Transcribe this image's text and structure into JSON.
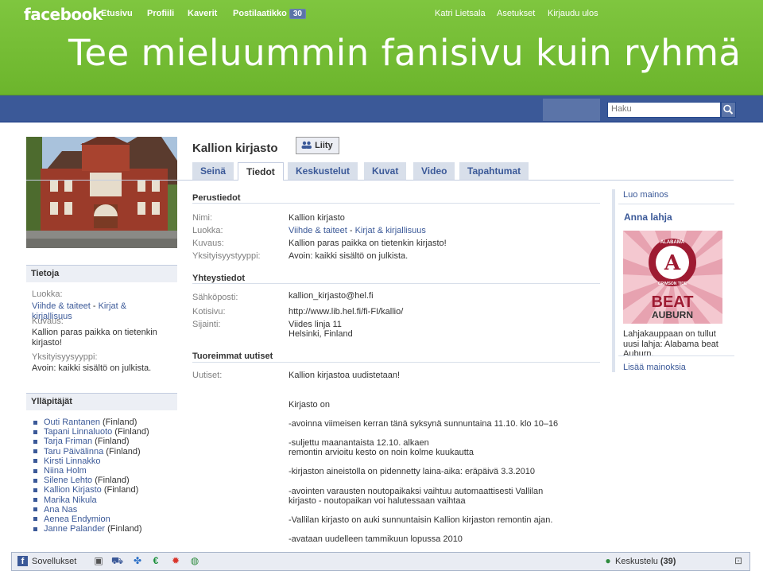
{
  "slide": {
    "title": "Tee mieluummin fanisivu kuin ryhmä"
  },
  "topbar": {
    "logo": "facebook",
    "nav": [
      "Etusivu",
      "Profiili",
      "Kaverit",
      "Postilaatikko"
    ],
    "inbox_count": "30",
    "user": "Katri Lietsala",
    "settings": "Asetukset",
    "logout": "Kirjaudu ulos",
    "search_placeholder": "Haku"
  },
  "page": {
    "name": "Kallion kirjasto",
    "join_label": "Liity",
    "tabs": [
      "Seinä",
      "Tiedot",
      "Keskustelut",
      "Kuvat",
      "Video",
      "Tapahtumat"
    ],
    "active_tab": "Tiedot"
  },
  "sidebar": {
    "info_heading": "Tietoja",
    "category_label": "Luokka:",
    "category_part1": "Viihde & taiteet",
    "category_sep": " - ",
    "category_part2": "Kirjat & kirjallisuus",
    "description_label": "Kuvaus:",
    "description": "Kallion paras paikka on tietenkin kirjasto!",
    "privacy_label": "Yksityisyysyyppi:",
    "privacy": "Avoin: kaikki sisältö on julkista.",
    "admins_heading": "Ylläpitäjät",
    "admins": [
      {
        "name": "Outi Rantanen",
        "suffix": " (Finland)"
      },
      {
        "name": "Tapani Linnaluoto",
        "suffix": " (Finland)"
      },
      {
        "name": "Tarja Friman",
        "suffix": " (Finland)"
      },
      {
        "name": "Taru Päivälinna",
        "suffix": " (Finland)"
      },
      {
        "name": "Kirsti Linnakko",
        "suffix": ""
      },
      {
        "name": "Niina Holm",
        "suffix": ""
      },
      {
        "name": "Silene Lehto",
        "suffix": " (Finland)"
      },
      {
        "name": "Kallion Kirjasto",
        "suffix": " (Finland)"
      },
      {
        "name": "Marika Nikula",
        "suffix": ""
      },
      {
        "name": "Ana Nas",
        "suffix": ""
      },
      {
        "name": "Aenea Endymion",
        "suffix": ""
      },
      {
        "name": "Janne Palander",
        "suffix": " (Finland)"
      }
    ]
  },
  "basic_info": {
    "heading": "Perustiedot",
    "name_label": "Nimi:",
    "name_value": "Kallion kirjasto",
    "category_label": "Luokka:",
    "description_label": "Kuvaus:",
    "description_value": "Kallion paras paikka on tietenkin kirjasto!",
    "privacy_label": "Yksityisyystyyppi:",
    "privacy_value": "Avoin: kaikki sisältö on julkista."
  },
  "contact": {
    "heading": "Yhteystiedot",
    "email_label": "Sähköposti:",
    "email": "kallion_kirjasto@hel.fi",
    "homepage_label": "Kotisivu:",
    "homepage": "http://www.lib.hel.fi/fi-FI/kallio/",
    "location_label": "Sijainti:",
    "street": "Viides linja 11",
    "city": "Helsinki, Finland"
  },
  "news": {
    "heading": "Tuoreimmat uutiset",
    "label": "Uutiset:",
    "lines": [
      "Kallion kirjastoa uudistetaan!",
      "Kirjasto on",
      "-avoinna viimeisen kerran tänä syksynä sunnuntaina 11.10. klo 10–16",
      "-suljettu maanantaista 12.10. alkaen",
      "remontin arvioitu kesto on noin kolme kuukautta",
      "-kirjaston aineistolla on pidennetty laina-aika: eräpäivä 3.3.2010",
      "-avointen varausten noutopaikaksi vaihtuu automaattisesti Vallilan",
      "kirjasto - noutopaikan voi halutessaan vaihtaa",
      "-Vallilan kirjasto on auki sunnuntaisin Kallion kirjaston remontin ajan.",
      "-avataan uudelleen tammikuun lopussa 2010"
    ]
  },
  "ads": {
    "create_ad": "Luo mainos",
    "title": "Anna lahja",
    "image_text_top": "ALABAMA",
    "image_text_ring": "CRIMSON TIDE",
    "image_text_big": "BEAT",
    "image_text_bottom": "AUBURN",
    "body": "Lahjakauppaan on tullut uusi lahja: Alabama beat Auburn.",
    "more_ads": "Lisää mainoksia"
  },
  "taskbar": {
    "apps_label": "Sovellukset",
    "chat_label": "Keskustelu",
    "chat_count": "(39)"
  },
  "colors": {
    "facebook_blue": "#3b5998",
    "slide_green": "#6cb52c",
    "crimson": "#9e1b32"
  }
}
